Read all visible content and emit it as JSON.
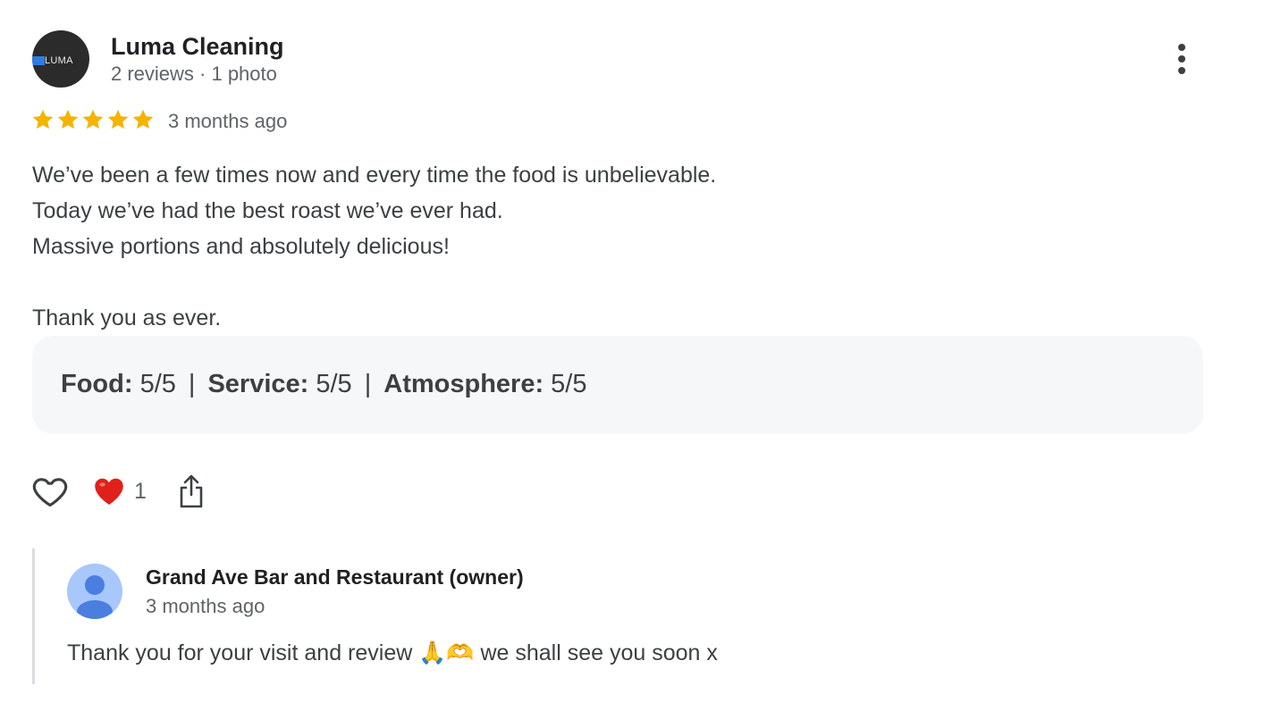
{
  "review": {
    "author": {
      "name": "Luma Cleaning",
      "stats": "2 reviews · 1 photo",
      "avatar_text": "LUMA",
      "avatar_bg": "#2b2b2b",
      "avatar_accent": "#2f7de1"
    },
    "rating": 5,
    "time": "3 months ago",
    "star_color": "#f4b400",
    "lines": [
      "We’ve been a few times now and every time the food is unbelievable.",
      "Today we’ve had the best roast we’ve ever had.",
      "Massive portions and absolutely delicious!",
      "Thank you as ever."
    ],
    "sub_ratings": [
      {
        "label": "Food:",
        "value": "5/5"
      },
      {
        "label": "Service:",
        "value": "5/5"
      },
      {
        "label": "Atmosphere:",
        "value": "5/5"
      }
    ],
    "reaction_count": "1",
    "icons": {
      "more": "more-vert-icon",
      "like": "heart-outline-icon",
      "reaction": "red-heart-emoji-icon",
      "share": "share-icon"
    }
  },
  "owner_reply": {
    "name": "Grand Ave Bar and Restaurant (owner)",
    "time": "3 months ago",
    "text_before": "Thank you for your visit and review ",
    "emojis": [
      "🙏",
      "🫶"
    ],
    "text_after": " we shall see you soon x",
    "avatar_bg": "#a8c7fa",
    "avatar_fg": "#4a7fe0"
  }
}
